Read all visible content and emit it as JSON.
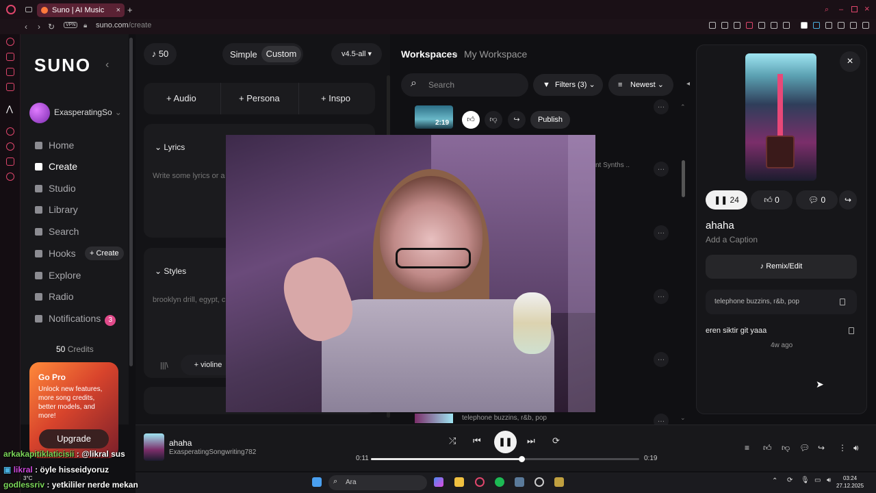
{
  "browser": {
    "tab_title": "Suno | AI Music",
    "url_host": "suno.com",
    "url_path": "/create",
    "vpn_label": "VPN"
  },
  "sidebar": {
    "logo": "SUNO",
    "username": "ExasperatingSo",
    "items": [
      {
        "label": "Home",
        "icon": "home-icon"
      },
      {
        "label": "Create",
        "icon": "create-icon",
        "active": true
      },
      {
        "label": "Studio",
        "icon": "studio-icon"
      },
      {
        "label": "Library",
        "icon": "library-icon"
      },
      {
        "label": "Search",
        "icon": "search-icon"
      },
      {
        "label": "Hooks",
        "icon": "hooks-icon"
      },
      {
        "label": "Explore",
        "icon": "explore-icon"
      },
      {
        "label": "Radio",
        "icon": "radio-icon"
      },
      {
        "label": "Notifications",
        "icon": "bell-icon"
      }
    ],
    "hooks_create": "+ Create",
    "notifications_count": "3",
    "credits_value": "50",
    "credits_label": "Credits",
    "gopro": {
      "title": "Go Pro",
      "text": "Unlock new features, more song credits, better models, and more!",
      "button": "Upgrade"
    }
  },
  "create": {
    "credits": "50",
    "mode_simple": "Simple",
    "mode_custom": "Custom",
    "model": "v4.5-all",
    "add_audio": "Audio",
    "add_persona": "Persona",
    "add_inspo": "Inspo",
    "lyrics_title": "Lyrics",
    "lyrics_placeholder": "Write some lyrics or a",
    "styles_title": "Styles",
    "styles_placeholder": "brooklyn drill, egypt, c",
    "style_chip": "violine"
  },
  "workspace": {
    "title": "Workspaces",
    "subtitle": "My Workspace",
    "search_placeholder": "Search",
    "filters": "Filters (3)",
    "sort": "Newest",
    "row1_duration": "2:19",
    "publish": "Publish",
    "row2_tags": "nt Synths ..",
    "row_last_tags": "telephone buzzins, r&b, pop"
  },
  "detail": {
    "plays": "24",
    "likes": "0",
    "comments": "0",
    "title": "ahaha",
    "caption": "Add a Caption",
    "remix": "Remix/Edit",
    "tags": "telephone buzzins, r&b, pop",
    "lyrics": "eren siktir git yaaa",
    "ago": "4w ago"
  },
  "player": {
    "title": "ahaha",
    "artist": "ExasperatingSongwriting782",
    "elapsed": "0:11",
    "duration": "0:19",
    "progress": 0.56
  },
  "chat": [
    {
      "user": "arkakapitiklaticisii",
      "text": ": @likral sus"
    },
    {
      "user": "likral",
      "text": ": öyle hisseidyoruz"
    },
    {
      "user": "godlessriv",
      "text": ": yetkililer nerde mekan"
    }
  ],
  "taskbar": {
    "search": "Ara",
    "weather": "3°C",
    "time": "03:24",
    "date": "27.12.2025"
  },
  "colors": {
    "accent_pink": "#e04a8a",
    "browser_accent": "#e0466c",
    "gopro_orange": "#ff8a3a"
  }
}
